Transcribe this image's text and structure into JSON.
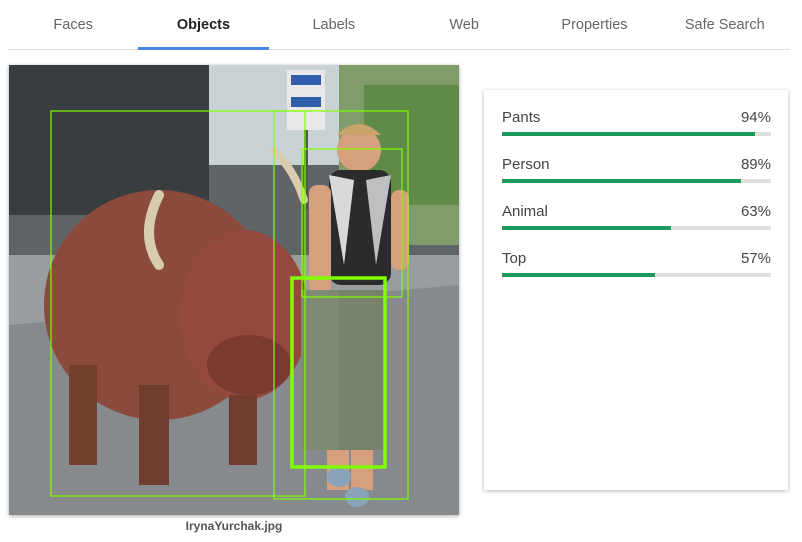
{
  "tabs": [
    {
      "label": "Faces",
      "active": false
    },
    {
      "label": "Objects",
      "active": true
    },
    {
      "label": "Labels",
      "active": false
    },
    {
      "label": "Web",
      "active": false
    },
    {
      "label": "Properties",
      "active": false
    },
    {
      "label": "Safe Search",
      "active": false
    }
  ],
  "image": {
    "caption": "IrynaYurchak.jpg",
    "box_color": "#7fff00"
  },
  "results": [
    {
      "label": "Pants",
      "score_text": "94%",
      "score": 0.94
    },
    {
      "label": "Person",
      "score_text": "89%",
      "score": 0.89
    },
    {
      "label": "Animal",
      "score_text": "63%",
      "score": 0.63
    },
    {
      "label": "Top",
      "score_text": "57%",
      "score": 0.57
    }
  ],
  "colors": {
    "accent": "#4a86e8",
    "bar": "#1a9a5c"
  }
}
